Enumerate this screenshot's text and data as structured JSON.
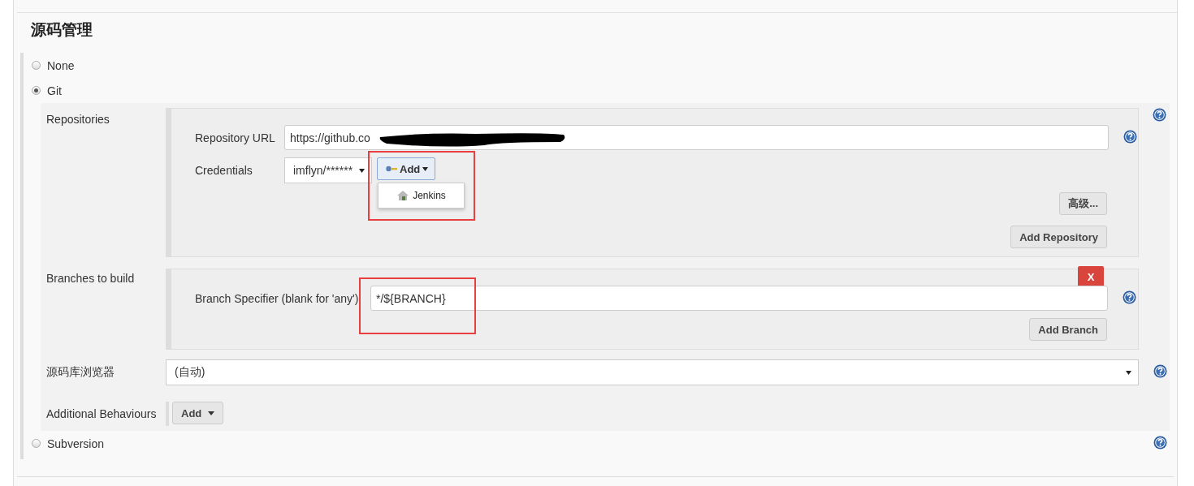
{
  "section_title": "源码管理",
  "scm_options": [
    {
      "label": "None",
      "selected": false
    },
    {
      "label": "Git",
      "selected": true
    },
    {
      "label": "Subversion",
      "selected": false
    }
  ],
  "git": {
    "repositories": {
      "label": "Repositories",
      "url": {
        "label": "Repository URL",
        "value": "https://github.co"
      },
      "credentials": {
        "label": "Credentials",
        "value": "imflyn/******",
        "add_button": "Add",
        "menu": [
          "Jenkins"
        ]
      },
      "advanced_button": "高级...",
      "add_button": "Add Repository"
    },
    "branches": {
      "label": "Branches to build",
      "specifier": {
        "label": "Branch Specifier (blank for 'any')",
        "value": "*/${BRANCH}"
      },
      "delete_button": "X",
      "add_button": "Add Branch"
    },
    "browser": {
      "label": "源码库浏览器",
      "value": "(自动)"
    },
    "behaviours": {
      "label": "Additional Behaviours",
      "add_button": "Add"
    }
  }
}
